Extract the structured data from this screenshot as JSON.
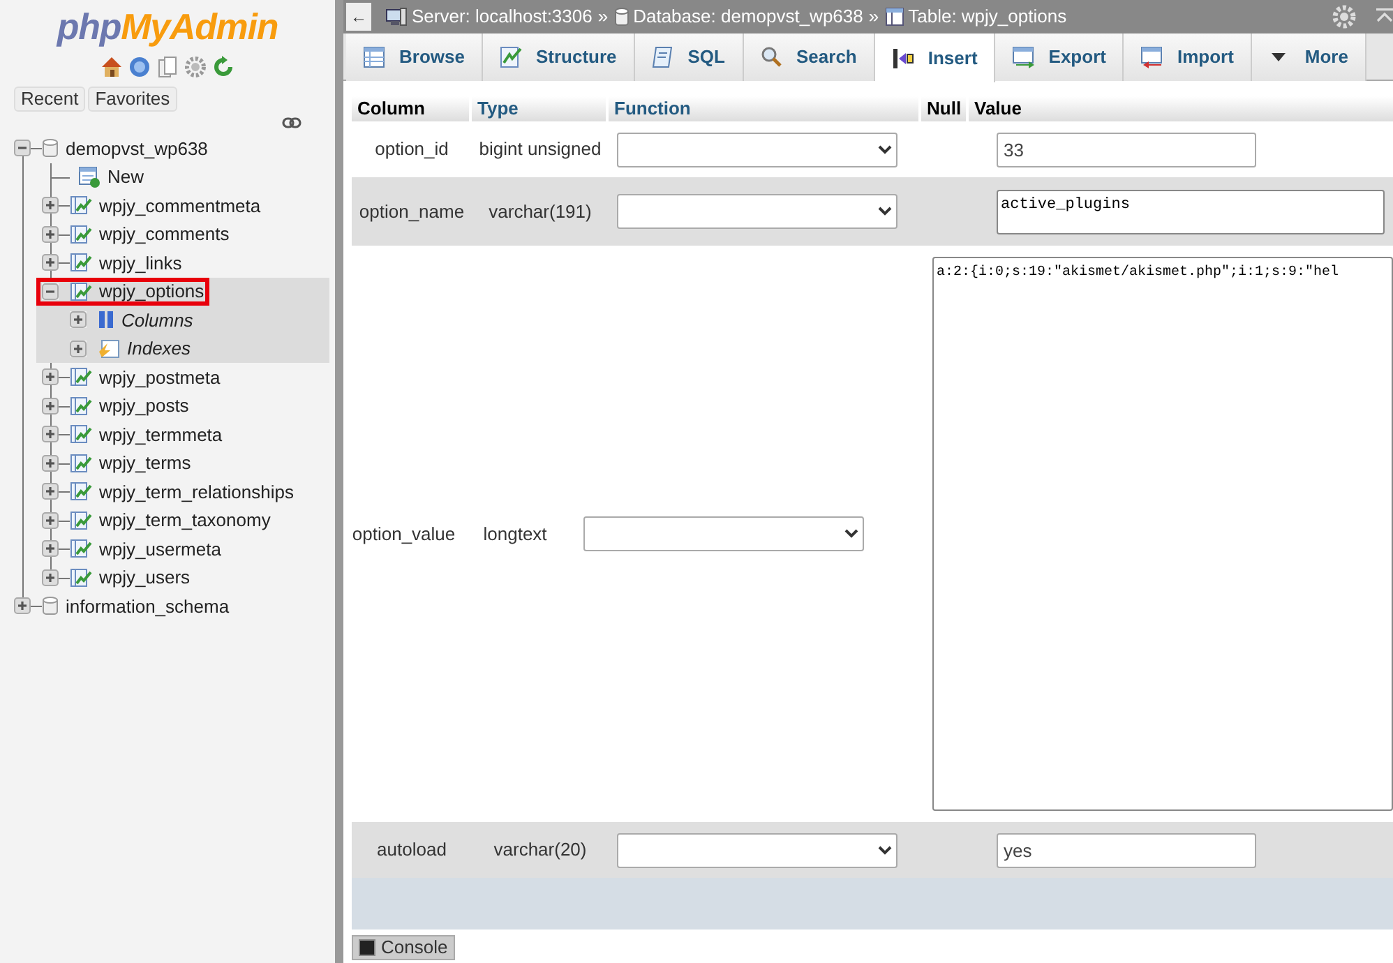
{
  "sidebar": {
    "logo": {
      "prefix": "php",
      "name": "MyAdmin"
    },
    "quick_links": [
      "Recent",
      "Favorites"
    ],
    "tree": [
      {
        "label": "demopvst_wp638",
        "kind": "database",
        "expanded": true,
        "selected": false,
        "highlighted": false,
        "children": [
          {
            "label": "New",
            "kind": "new",
            "selected": false,
            "highlighted": false
          },
          {
            "label": "wpjy_commentmeta",
            "kind": "table",
            "expanded": false,
            "selected": false,
            "highlighted": false
          },
          {
            "label": "wpjy_comments",
            "kind": "table",
            "expanded": false,
            "selected": false,
            "highlighted": false
          },
          {
            "label": "wpjy_links",
            "kind": "table",
            "expanded": false,
            "selected": false,
            "highlighted": false
          },
          {
            "label": "wpjy_options",
            "kind": "table",
            "expanded": true,
            "selected": true,
            "highlighted": true,
            "children": [
              {
                "label": "Columns",
                "kind": "columns",
                "expanded": false,
                "selected": true,
                "highlighted": false
              },
              {
                "label": "Indexes",
                "kind": "indexes",
                "expanded": false,
                "selected": true,
                "highlighted": false
              }
            ]
          },
          {
            "label": "wpjy_postmeta",
            "kind": "table",
            "expanded": false,
            "selected": false,
            "highlighted": false
          },
          {
            "label": "wpjy_posts",
            "kind": "table",
            "expanded": false,
            "selected": false,
            "highlighted": false
          },
          {
            "label": "wpjy_termmeta",
            "kind": "table",
            "expanded": false,
            "selected": false,
            "highlighted": false
          },
          {
            "label": "wpjy_terms",
            "kind": "table",
            "expanded": false,
            "selected": false,
            "highlighted": false
          },
          {
            "label": "wpjy_term_relationships",
            "kind": "table",
            "expanded": false,
            "selected": false,
            "highlighted": false
          },
          {
            "label": "wpjy_term_taxonomy",
            "kind": "table",
            "expanded": false,
            "selected": false,
            "highlighted": false
          },
          {
            "label": "wpjy_usermeta",
            "kind": "table",
            "expanded": false,
            "selected": false,
            "highlighted": false
          },
          {
            "label": "wpjy_users",
            "kind": "table",
            "expanded": false,
            "selected": false,
            "highlighted": false
          }
        ]
      },
      {
        "label": "information_schema",
        "kind": "database",
        "expanded": false,
        "selected": false,
        "highlighted": false
      }
    ]
  },
  "top_bar": {
    "back": "←",
    "separator": "»",
    "breadcrumb": [
      {
        "kind": "server",
        "text": "Server: localhost:3306"
      },
      {
        "kind": "database",
        "text": "Database: demopvst_wp638"
      },
      {
        "kind": "table",
        "text": "Table: wpjy_options"
      }
    ]
  },
  "tabs": [
    {
      "label": "Browse",
      "kind": "browse",
      "selected": false
    },
    {
      "label": "Structure",
      "kind": "structure",
      "selected": false
    },
    {
      "label": "SQL",
      "kind": "sql",
      "selected": false
    },
    {
      "label": "Search",
      "kind": "search",
      "selected": false
    },
    {
      "label": "Insert",
      "kind": "insert",
      "selected": true
    },
    {
      "label": "Export",
      "kind": "export",
      "selected": false
    },
    {
      "label": "Import",
      "kind": "import",
      "selected": false
    },
    {
      "label": "More",
      "kind": "more",
      "selected": false
    }
  ],
  "insert_form": {
    "headers": [
      {
        "label": "Column",
        "kind": "plain"
      },
      {
        "label": "Type",
        "kind": "link"
      },
      {
        "label": "Function",
        "kind": "link"
      },
      {
        "label": "Null",
        "kind": "plain"
      },
      {
        "label": "Value",
        "kind": "plain"
      }
    ],
    "rows": [
      {
        "column": "option_id",
        "type": "bigint unsigned",
        "value": "33",
        "kind": "input"
      },
      {
        "column": "option_name",
        "type": "varchar(191)",
        "value": "active_plugins",
        "kind": "textarea"
      },
      {
        "column": "option_value",
        "type": "longtext",
        "value": "a:2:{i:0;s:19:\"akismet/akismet.php\";i:1;s:9:\"hel",
        "kind": "long_textarea"
      },
      {
        "column": "autoload",
        "type": "varchar(20)",
        "value": "yes",
        "kind": "input"
      }
    ]
  },
  "console": {
    "label": "Console"
  }
}
